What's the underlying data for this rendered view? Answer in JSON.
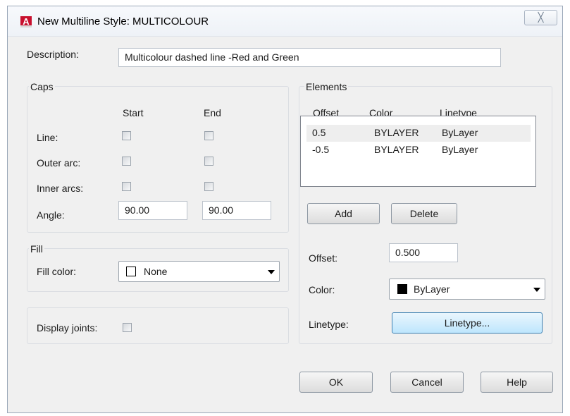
{
  "dialog": {
    "title": "New Multiline Style: MULTICOLOUR",
    "app_icon_letter": "A",
    "close_glyph": "╳"
  },
  "description": {
    "label": "Description:",
    "value": "Multicolour dashed line -Red and Green"
  },
  "caps": {
    "group_label": "Caps",
    "start_header": "Start",
    "end_header": "End",
    "line_label": "Line:",
    "line_start_checked": false,
    "line_end_checked": false,
    "outer_arc_label": "Outer arc:",
    "outer_arc_start_checked": false,
    "outer_arc_end_checked": false,
    "inner_arcs_label": "Inner arcs:",
    "inner_arcs_start_checked": false,
    "inner_arcs_end_checked": false,
    "angle_label": "Angle:",
    "angle_start": "90.00",
    "angle_end": "90.00"
  },
  "fill": {
    "group_label": "Fill",
    "fill_color_label": "Fill color:",
    "fill_color_value": "None",
    "fill_swatch_color": "#ffffff"
  },
  "joints": {
    "label": "Display joints:",
    "checked": false
  },
  "elements": {
    "group_label": "Elements",
    "columns": [
      "Offset",
      "Color",
      "Linetype"
    ],
    "rows": [
      {
        "offset": "0.5",
        "color": "BYLAYER",
        "linetype": "ByLayer",
        "selected": true
      },
      {
        "offset": "-0.5",
        "color": "BYLAYER",
        "linetype": "ByLayer",
        "selected": false
      }
    ],
    "add_label": "Add",
    "delete_label": "Delete",
    "offset_label": "Offset:",
    "offset_value": "0.500",
    "color_label": "Color:",
    "color_value": "ByLayer",
    "color_swatch": "#000000",
    "linetype_label": "Linetype:",
    "linetype_button": "Linetype..."
  },
  "buttons": {
    "ok": "OK",
    "cancel": "Cancel",
    "help": "Help"
  }
}
